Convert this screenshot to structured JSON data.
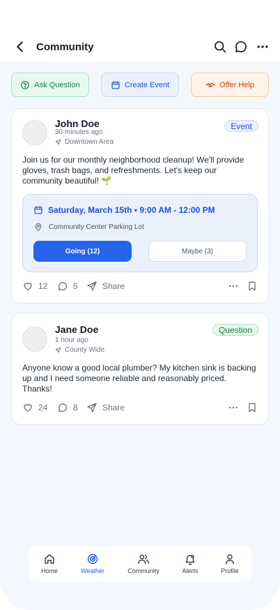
{
  "header": {
    "title": "Community"
  },
  "quick_actions": {
    "ask": "Ask Question",
    "event": "Create Event",
    "help": "Offer Help"
  },
  "posts": [
    {
      "author": "John Doe",
      "time": "30 minutes ago",
      "location": "Downtown Area",
      "tag": "Event",
      "text": "Join us for our monthly neighborhood cleanup! We'll provide gloves, trash bags, and refreshments. Let's keep our community beautiful! 🌱",
      "event": {
        "date": "Saturday, March 15th • 9:00 AM - 12:00 PM",
        "place": "Community Center Parking Lot",
        "going": "Going (12)",
        "maybe": "Maybe (3)"
      },
      "likes": "12",
      "comments": "5",
      "share": "Share"
    },
    {
      "author": "Jane Doe",
      "time": "1 hour ago",
      "location": "County Wide",
      "tag": "Question",
      "text": "Anyone know a good local plumber? My kitchen sink is backing up and I need someone reliable and reasonably priced. Thanks!",
      "likes": "24",
      "comments": "8",
      "share": "Share"
    }
  ],
  "tabbar": {
    "items": [
      {
        "label": "Home",
        "icon": "home-icon"
      },
      {
        "label": "Weather",
        "icon": "radar-icon",
        "active": true
      },
      {
        "label": "Community",
        "icon": "users-icon"
      },
      {
        "label": "Alerts",
        "icon": "bell-icon"
      },
      {
        "label": "Profile",
        "icon": "user-icon"
      }
    ]
  },
  "colors": {
    "accent": "#2563eb",
    "question": "#15803d",
    "help": "#c2410c",
    "background": "#f5f7fe"
  }
}
